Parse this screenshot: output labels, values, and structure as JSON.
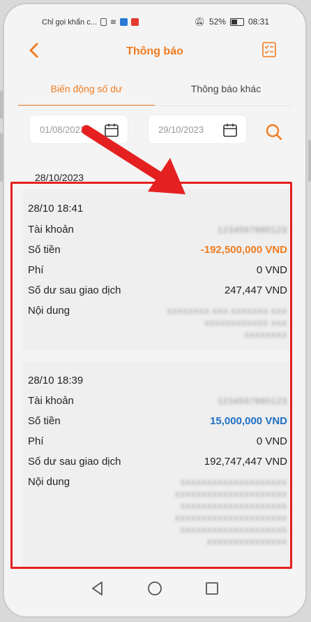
{
  "status_bar": {
    "carrier": "Chỉ gọi khẩn c...",
    "battery": "52%",
    "time": "08:31"
  },
  "header": {
    "title": "Thông báo"
  },
  "tabs": [
    {
      "label": "Biến động số dư",
      "active": true
    },
    {
      "label": "Thông báo khác",
      "active": false
    }
  ],
  "filters": {
    "from_date": "01/08/2023",
    "to_date": "29/10/2023"
  },
  "group_date": "28/10/2023",
  "labels": {
    "account": "Tài khoản",
    "amount": "Số tiền",
    "fee": "Phí",
    "balance_after": "Số dư sau giao dịch",
    "content": "Nội dung"
  },
  "transactions": [
    {
      "time": "28/10 18:41",
      "account": "1234567890123",
      "amount": "-192,500,000 VND",
      "fee": "0 VND",
      "balance_after": "247,447 VND",
      "content": [
        "XXXXXXXX XXX XXXXXXX XXX",
        "XXXXXXXXXXXX XXX",
        "XXXXXXXX"
      ]
    },
    {
      "time": "28/10 18:39",
      "account": "1234567890123",
      "amount": "15,000,000 VND",
      "fee": "0 VND",
      "balance_after": "192,747,447 VND",
      "content": [
        "XXXXXXXXXXXXXXXXXXXX",
        "XXXXXXXXXXXXXXXXXXXXX",
        "XXXXXXXXXXXXXXXXXXXX",
        "XXXXXXXXXXXXXXXXXXXXX",
        "XXXXXXXXXXXXXXXXXXXX",
        "XXXXXXXXXXXXXXX"
      ]
    }
  ],
  "colors": {
    "accent": "#f07c21",
    "credit": "#1f6fc5",
    "annotation": "#e52020"
  },
  "icons": [
    "back-arrow-icon",
    "checklist-icon",
    "calendar-icon",
    "search-icon",
    "nav-back-icon",
    "nav-home-icon",
    "nav-recents-icon"
  ]
}
